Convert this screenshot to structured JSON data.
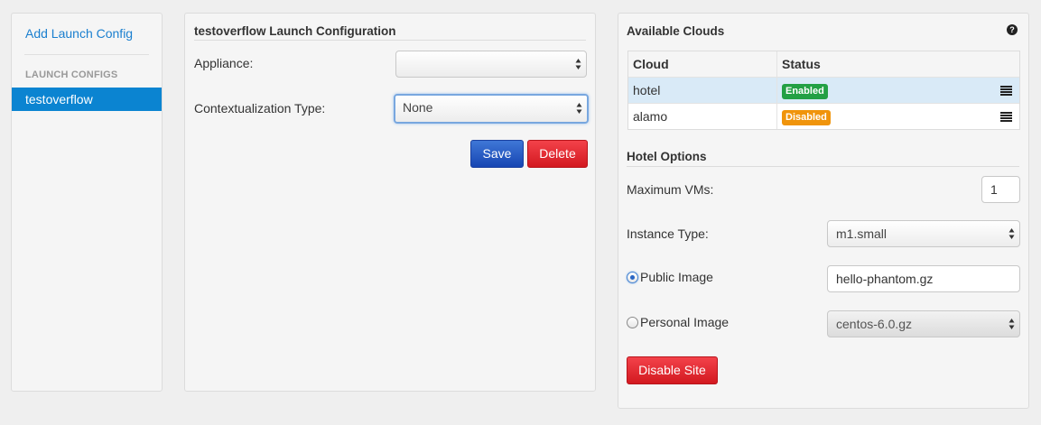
{
  "sidebar": {
    "add_link": "Add Launch Config",
    "header": "LAUNCH CONFIGS",
    "items": [
      {
        "label": "testoverflow",
        "active": true
      }
    ]
  },
  "config": {
    "title": "testoverflow Launch Configuration",
    "appliance_label": "Appliance:",
    "appliance_value": "",
    "contextualization_label": "Contextualization Type:",
    "contextualization_value": "None",
    "save_label": "Save",
    "delete_label": "Delete"
  },
  "clouds": {
    "title": "Available Clouds",
    "help_glyph": "?",
    "columns": [
      "Cloud",
      "Status"
    ],
    "rows": [
      {
        "name": "hotel",
        "status": "Enabled",
        "status_color": "#23a044",
        "selected": true
      },
      {
        "name": "alamo",
        "status": "Disabled",
        "status_color": "#f0940b",
        "selected": false
      }
    ]
  },
  "options": {
    "title": "Hotel Options",
    "max_vms_label": "Maximum VMs:",
    "max_vms_value": "1",
    "instance_type_label": "Instance Type:",
    "instance_type_value": "m1.small",
    "public_image_label": "Public Image",
    "public_image_value": "hello-phantom.gz",
    "public_image_checked": true,
    "personal_image_label": "Personal Image",
    "personal_image_value": "centos-6.0.gz",
    "personal_image_checked": false,
    "disable_site_label": "Disable Site"
  },
  "colors": {
    "accent_blue": "#0b84d1",
    "save_blue": "#1746b3",
    "danger_red": "#d31920",
    "enabled_green": "#23a044",
    "disabled_orange": "#f0940b"
  }
}
